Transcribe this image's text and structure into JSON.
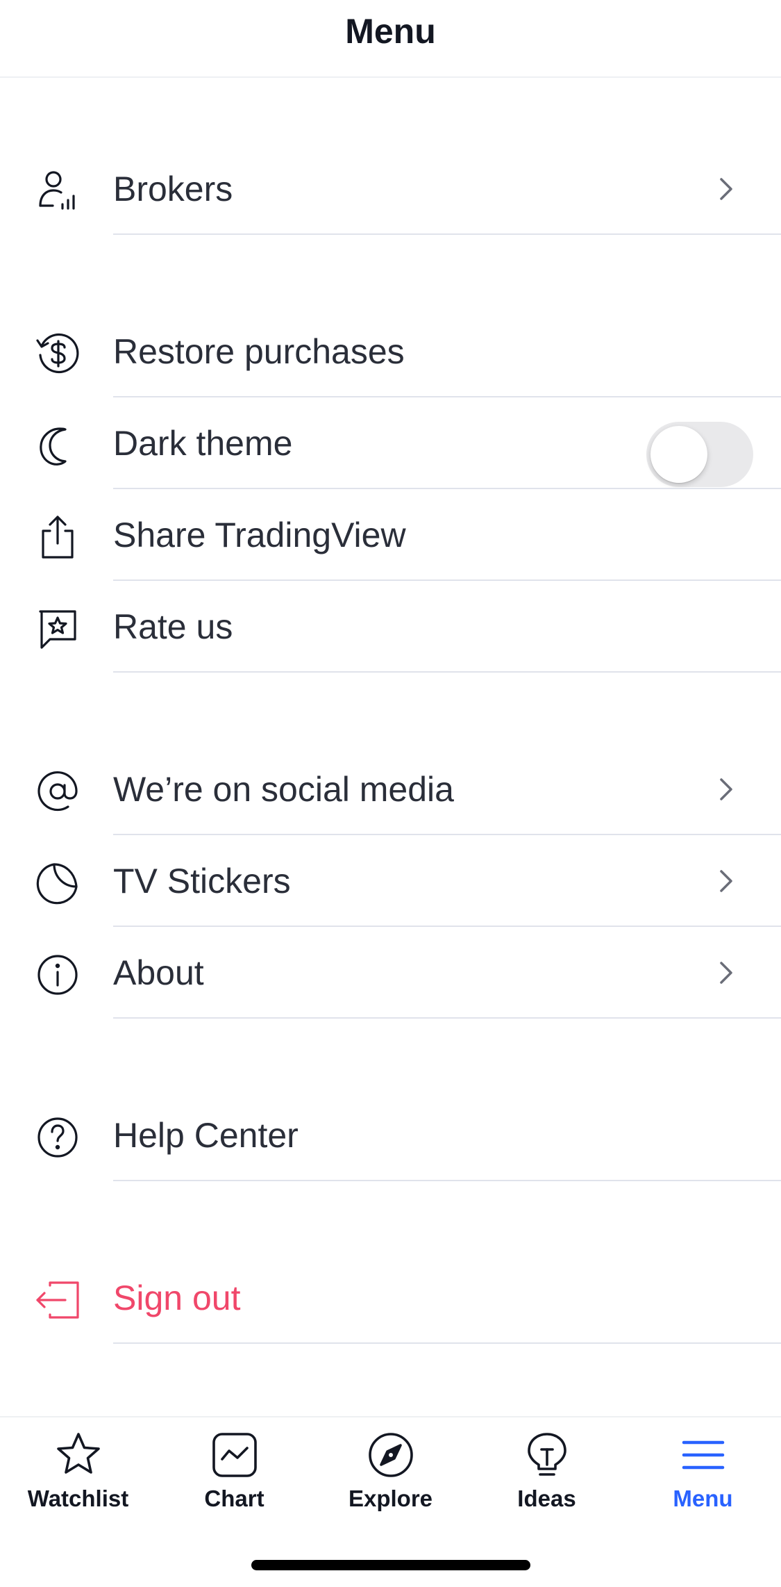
{
  "header": {
    "title": "Menu"
  },
  "menu": {
    "brokers": "Brokers",
    "restore_purchases": "Restore purchases",
    "dark_theme": "Dark theme",
    "dark_theme_enabled": false,
    "share": "Share TradingView",
    "rate_us": "Rate us",
    "social_media": "We’re on social media",
    "tv_stickers": "TV Stickers",
    "about": "About",
    "help_center": "Help Center",
    "sign_out": "Sign out"
  },
  "tabbar": {
    "tabs": [
      {
        "label": "Watchlist",
        "icon": "star-icon",
        "active": false
      },
      {
        "label": "Chart",
        "icon": "chart-icon",
        "active": false
      },
      {
        "label": "Explore",
        "icon": "compass-icon",
        "active": false
      },
      {
        "label": "Ideas",
        "icon": "lightbulb-icon",
        "active": false
      },
      {
        "label": "Menu",
        "icon": "hamburger-icon",
        "active": true
      }
    ]
  },
  "colors": {
    "accent": "#2962ff",
    "danger": "#f0476a",
    "text": "#2a2e39"
  }
}
